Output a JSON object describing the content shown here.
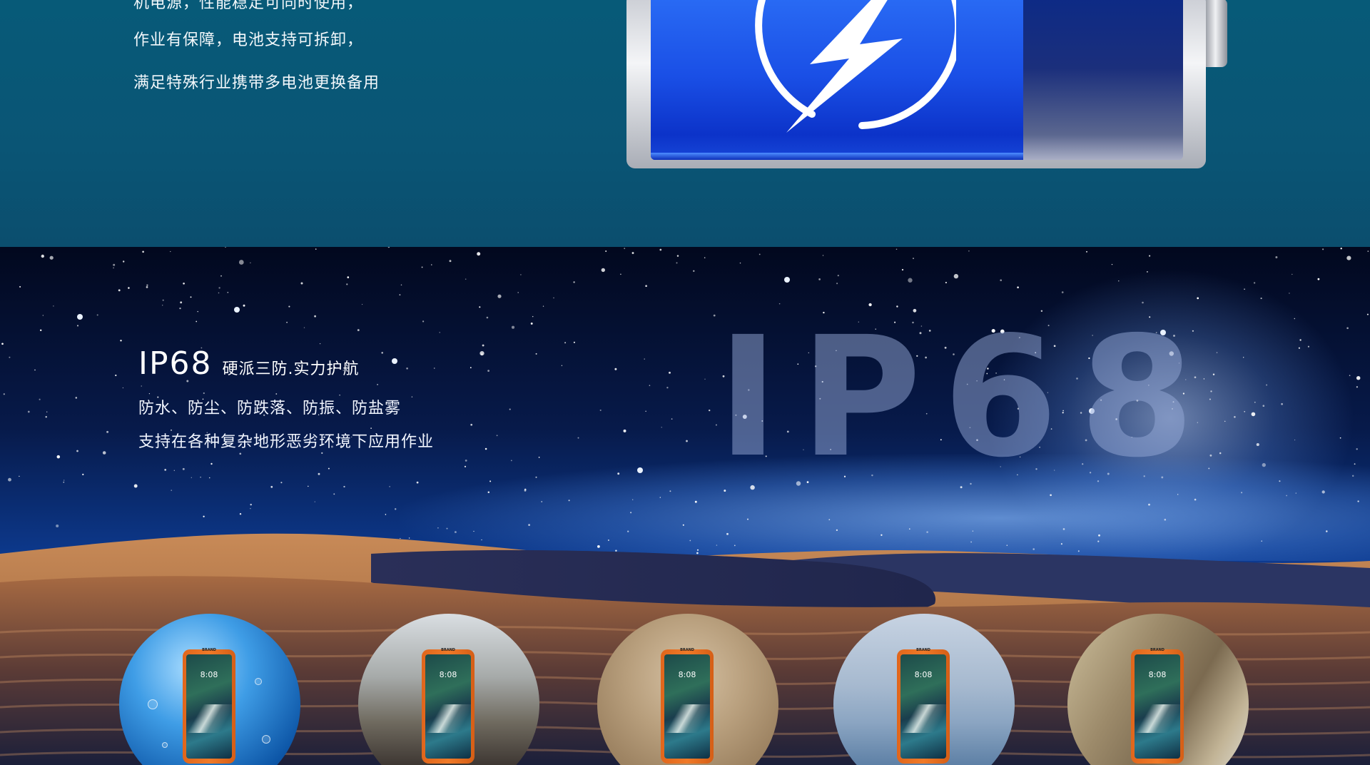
{
  "battery_section": {
    "lines": [
      "机电源，性能稳定可同时使用，",
      "作业有保障，电池支持可拆卸，",
      "满足特殊行业携带多电池更换备用"
    ],
    "charge_level": 0.7,
    "icon": "lightning-bolt-icon"
  },
  "ip_section": {
    "title": "IP68",
    "subtitle": "硬派三防.实力护航",
    "line1": "防水、防尘、防跌落、防振、防盐雾",
    "line2": "支持在各种复杂地形恶劣环境下应用作业",
    "watermark": "IP68"
  },
  "scenarios": [
    {
      "name": "water",
      "phone_brand": "BRAND",
      "phone_time": "8:08"
    },
    {
      "name": "explosion",
      "phone_brand": "BRAND",
      "phone_time": "8:08"
    },
    {
      "name": "sandstorm",
      "phone_brand": "BRAND",
      "phone_time": "8:08"
    },
    {
      "name": "sea-fog",
      "phone_brand": "BRAND",
      "phone_time": "8:08"
    },
    {
      "name": "rock-quarry",
      "phone_brand": "BRAND",
      "phone_time": "8:08"
    }
  ],
  "colors": {
    "top_bg": "#075a78",
    "battery_blue": "#1a4fe6",
    "phone_orange": "#f07a28"
  }
}
